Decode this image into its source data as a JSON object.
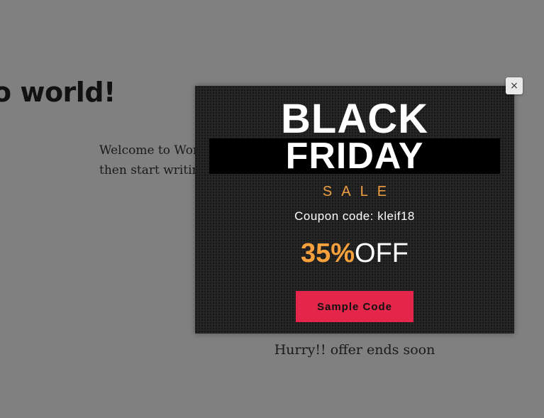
{
  "background_page": {
    "post_title": "o world!",
    "post_excerpt": "Welcome to WordPress. This is your first post. Edit or delete it, then start writing!"
  },
  "popup": {
    "close_icon": "×",
    "heading_line1": "BLACK",
    "heading_line2": "FRIDAY",
    "sale_label": "SALE",
    "coupon_text": "Coupon code: kleif18",
    "discount_percent": "35%",
    "discount_suffix": "OFF",
    "button_label": "Sample Code",
    "footer_text": "Hurry!! offer ends soon"
  },
  "colors": {
    "overlay": "#808080",
    "popup_bg": "#262626",
    "accent_orange": "#f7a13c",
    "button_red": "#e5264b"
  }
}
